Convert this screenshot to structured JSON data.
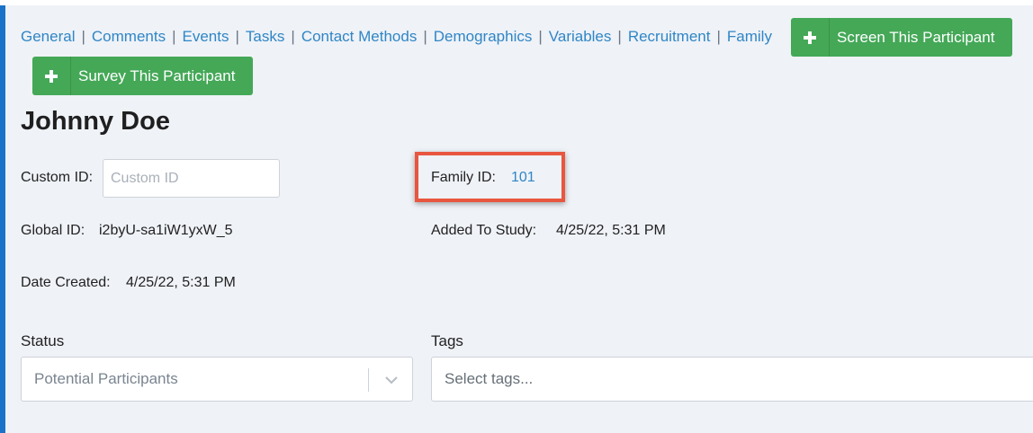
{
  "nav": {
    "links": [
      "General",
      "Comments",
      "Events",
      "Tasks",
      "Contact Methods",
      "Demographics",
      "Variables",
      "Recruitment",
      "Family"
    ],
    "separator": "|"
  },
  "buttons": {
    "screen_label": "Screen This Participant",
    "survey_label": "Survey This Participant"
  },
  "participant": {
    "name": "Johnny Doe",
    "custom_id_label": "Custom ID:",
    "custom_id_value": "",
    "custom_id_placeholder": "Custom ID",
    "family_id_label": "Family ID:",
    "family_id_value": "101",
    "global_id_label": "Global ID:",
    "global_id_value": "i2byU-sa1iW1yxW_5",
    "added_label": "Added To Study:",
    "added_value": "4/25/22, 5:31 PM",
    "date_created_label": "Date Created:",
    "date_created_value": "4/25/22, 5:31 PM"
  },
  "status": {
    "label": "Status",
    "selected": "Potential Participants"
  },
  "tags": {
    "label": "Tags",
    "placeholder": "Select tags..."
  },
  "colors": {
    "accent": "#1a73c8",
    "link": "#2f86c6",
    "button_green": "#44a857",
    "highlight": "#e8563f",
    "panel_bg": "#eff2f7"
  },
  "icons": {
    "button_icon": "plus-icon",
    "select_icon": "chevron-down-icon"
  }
}
